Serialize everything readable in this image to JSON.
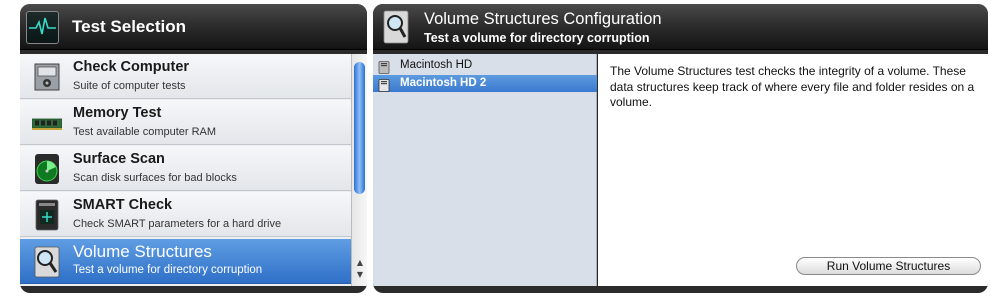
{
  "left_panel": {
    "title": "Test Selection",
    "items": [
      {
        "title": "Check Computer",
        "subtitle": "Suite of computer tests",
        "icon": "computer-icon"
      },
      {
        "title": "Memory Test",
        "subtitle": "Test available computer RAM",
        "icon": "ram-chip-icon"
      },
      {
        "title": "Surface Scan",
        "subtitle": "Scan disk surfaces for bad blocks",
        "icon": "radar-disk-icon"
      },
      {
        "title": "SMART Check",
        "subtitle": "Check SMART parameters for a hard drive",
        "icon": "drive-health-icon"
      },
      {
        "title": "Volume Structures",
        "subtitle": "Test a volume for directory corruption",
        "icon": "magnifier-drive-icon",
        "selected": true
      }
    ]
  },
  "right_panel": {
    "title": "Volume Structures Configuration",
    "subtitle": "Test a volume for directory corruption",
    "volumes": [
      {
        "label": "Macintosh HD",
        "selected": false
      },
      {
        "label": "Macintosh HD 2",
        "selected": true
      }
    ],
    "description": "The Volume Structures test checks the integrity of a volume. These data structures keep track of where every file and folder resides on a volume.",
    "run_button_label": "Run Volume Structures"
  },
  "colors": {
    "selection_blue": "#3f7fd4",
    "header_dark": "#1c1c1c",
    "accent_teal": "#38d8c8"
  }
}
